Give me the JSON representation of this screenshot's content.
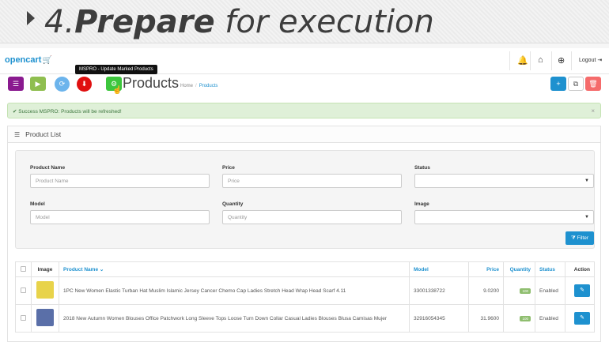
{
  "banner": {
    "number": "4.",
    "strong": "Prepare",
    "rest": " for execution"
  },
  "topbar": {
    "logo": "opencart",
    "logout_label": "Logout"
  },
  "tooltip": "MSPRO - Update Marked Products",
  "page": {
    "title": "Products",
    "breadcrumb": [
      "Home",
      "Products"
    ]
  },
  "toolbar": {
    "colors": {
      "purple": "#8a1a8f",
      "green": "#8fbe4f",
      "lightblue": "#6cb4ec",
      "red": "#e01010",
      "brightgreen": "#3dc63d",
      "blue": "#1e91cf",
      "pink": "#f56b6b"
    }
  },
  "alert": {
    "text": "Success MSPRO: Products will be refreshed!",
    "close": "×"
  },
  "panel": {
    "title": "Product List"
  },
  "filter": {
    "product_name": {
      "label": "Product Name",
      "placeholder": "Product Name"
    },
    "price": {
      "label": "Price",
      "placeholder": "Price"
    },
    "status": {
      "label": "Status",
      "value": ""
    },
    "model": {
      "label": "Model",
      "placeholder": "Model"
    },
    "quantity": {
      "label": "Quantity",
      "placeholder": "Quantity"
    },
    "image": {
      "label": "Image",
      "value": ""
    },
    "button": "Filter"
  },
  "table": {
    "headers": {
      "image": "Image",
      "name": "Product Name",
      "model": "Model",
      "price": "Price",
      "quantity": "Quantity",
      "status": "Status",
      "action": "Action"
    },
    "rows": [
      {
        "name": "1PC New Women Elastic Turban Hat Muslim Islamic Jersey Cancer Chemo Cap Ladies Stretch Head Wrap Head Scarf 4.11",
        "model": "33001338722",
        "price": "9.0200",
        "quantity": "100",
        "status": "Enabled",
        "thumb_color": "#e8d34a"
      },
      {
        "name": "2018 New Autumn Women Blouses Office Patchwork Long Sleeve Tops Loose Turn Down Collar Casual Ladies Blouses Blusa Camisas Mujer",
        "model": "32916054345",
        "price": "31.9600",
        "quantity": "100",
        "status": "Enabled",
        "thumb_color": "#5a6fa8"
      }
    ]
  }
}
